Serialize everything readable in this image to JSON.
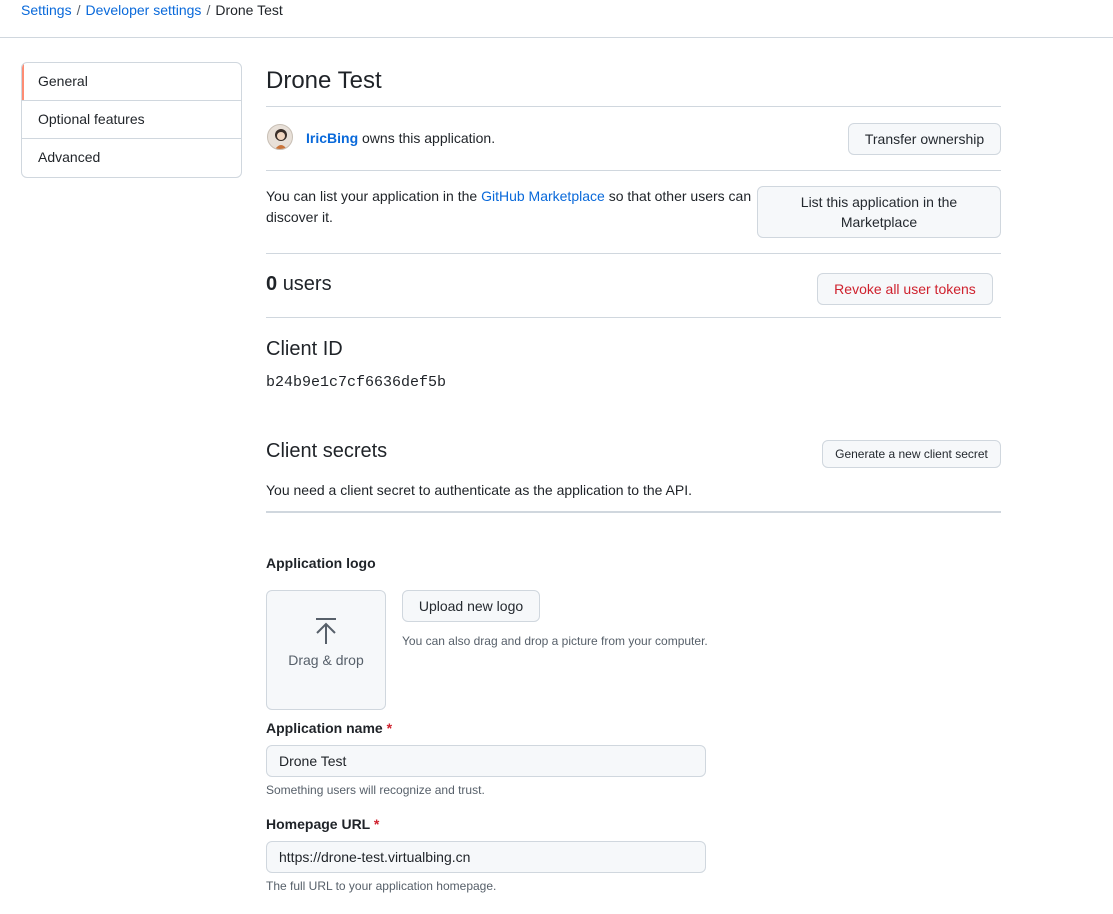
{
  "breadcrumb": {
    "settings": "Settings",
    "developer_settings": "Developer settings",
    "current": "Drone Test",
    "separator": "/"
  },
  "menu": {
    "items": [
      {
        "label": "General"
      },
      {
        "label": "Optional features"
      },
      {
        "label": "Advanced"
      }
    ]
  },
  "app": {
    "title": "Drone Test",
    "owner": "IricBing",
    "owner_suffix": "owns this application.",
    "transfer_button": "Transfer ownership",
    "marketplace_prefix": "You can list your application in the",
    "marketplace_link": "GitHub Marketplace",
    "marketplace_suffix": "so that other users can discover it.",
    "list_button": "List this application in the Marketplace",
    "users_count": "0",
    "users_label": "users",
    "revoke_button": "Revoke all user tokens",
    "client_id_heading": "Client ID",
    "client_id": "b24b9e1c7cf6636def5b",
    "client_secrets_heading": "Client secrets",
    "generate_secret_button": "Generate a new client secret",
    "client_secrets_desc": "You need a client secret to authenticate as the application to the API."
  },
  "logo": {
    "label": "Application logo",
    "dropzone_text": "Drag & drop",
    "upload_button": "Upload new logo",
    "note": "You can also drag and drop a picture from your computer."
  },
  "form": {
    "name_label": "Application name",
    "name_value": "Drone Test",
    "name_note": "Something users will recognize and trust.",
    "homepage_label": "Homepage URL",
    "homepage_value": "https://drone-test.virtualbing.cn",
    "homepage_note": "The full URL to your application homepage.",
    "required_mark": "*"
  },
  "icons": {
    "upload": "upload-arrow-icon",
    "avatar": "user-avatar"
  },
  "colors": {
    "link": "#0969da",
    "danger": "#cf222e",
    "selected_marker": "#fd8c73",
    "border": "#d0d7de"
  }
}
